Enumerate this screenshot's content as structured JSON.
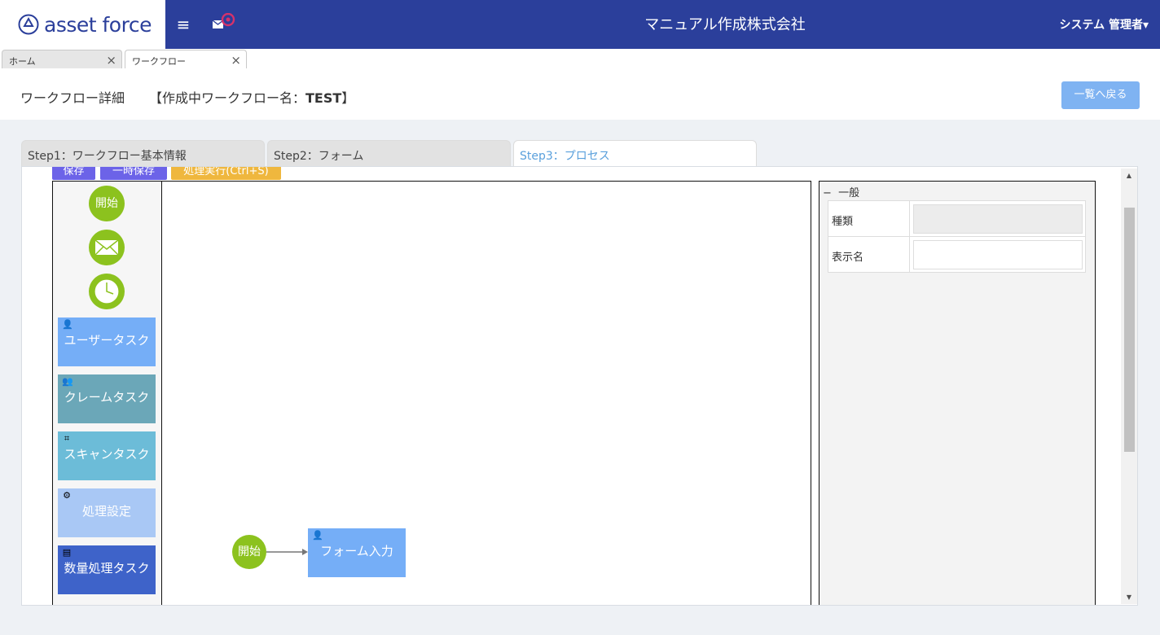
{
  "app": {
    "logo_text": "asset force",
    "company": "マニュアル作成株式会社",
    "user": "システム 管理者"
  },
  "tabs": [
    {
      "label": "ホーム"
    },
    {
      "label": "ワークフロー"
    }
  ],
  "header": {
    "title": "ワークフロー詳細",
    "wf_prefix": "【作成中ワークフロー名：",
    "wf_name": "TEST",
    "wf_suffix": "】",
    "back_button": "一覧へ戻る"
  },
  "steps": [
    {
      "label": "Step1：ワークフロー基本情報"
    },
    {
      "label": "Step2：フォーム"
    },
    {
      "label": "Step3：プロセス"
    }
  ],
  "toolbar": {
    "save": "保存",
    "temp_save": "一時保存",
    "preview": "処理実行(Ctrl+S)"
  },
  "palette": {
    "start": "開始",
    "tasks": [
      {
        "label": "ユーザータスク",
        "color": "#75aef7"
      },
      {
        "label": "クレームタスク",
        "color": "#6ba7b8"
      },
      {
        "label": "スキャンタスク",
        "color": "#6cbcd8"
      },
      {
        "label": "処理設定",
        "color": "#a9c8f5"
      },
      {
        "label": "数量処理タスク",
        "color": "#3e63c9"
      }
    ]
  },
  "canvas": {
    "start": "開始",
    "task": "フォーム入力"
  },
  "props": {
    "section": "一般",
    "rows": [
      {
        "label": "種類",
        "value": ""
      },
      {
        "label": "表示名",
        "value": ""
      }
    ]
  }
}
